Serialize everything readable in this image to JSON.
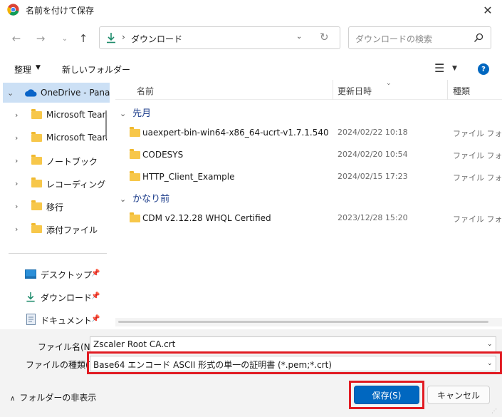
{
  "window": {
    "title": "名前を付けて保存",
    "close": "✕"
  },
  "address": {
    "path_label": "ダウンロード"
  },
  "search": {
    "placeholder": "ダウンロードの検索"
  },
  "toolbar": {
    "organize": "整理",
    "new_folder": "新しいフォルダー",
    "help": "?"
  },
  "sidebar": {
    "onedrive": "OneDrive - Pana",
    "folders": [
      "Microsoft Tean",
      "Microsoft Tean",
      "ノートブック",
      "レコーディング",
      "移行",
      "添付ファイル"
    ],
    "quick": [
      "デスクトップ",
      "ダウンロード",
      "ドキュメント"
    ]
  },
  "columns": {
    "name": "名前",
    "modified": "更新日時",
    "type": "種類"
  },
  "groups": [
    {
      "label": "先月",
      "rows": [
        {
          "name": "uaexpert-bin-win64-x86_64-ucrt-v1.7.1.540",
          "date": "2024/02/22 10:18",
          "type": "ファイル フォルダー"
        },
        {
          "name": "CODESYS",
          "date": "2024/02/20 10:54",
          "type": "ファイル フォルダー"
        },
        {
          "name": "HTTP_Client_Example",
          "date": "2024/02/15 17:23",
          "type": "ファイル フォルダー"
        }
      ]
    },
    {
      "label": "かなり前",
      "rows": [
        {
          "name": "CDM v2.12.28 WHQL Certified",
          "date": "2023/12/28 15:20",
          "type": "ファイル フォルダー"
        }
      ]
    }
  ],
  "form": {
    "filename_label": "ファイル名(N):",
    "filename_value": "Zscaler Root CA.crt",
    "filetype_label": "ファイルの種類(T):",
    "filetype_value": "Base64 エンコード ASCII 形式の単一の証明書 (*.pem;*.crt)",
    "hide_folders": "フォルダーの非表示",
    "save": "保存(S)",
    "cancel": "キャンセル"
  },
  "colors": {
    "accent": "#0067c0",
    "highlight": "#e11b22",
    "folder": "#f7c74a"
  }
}
